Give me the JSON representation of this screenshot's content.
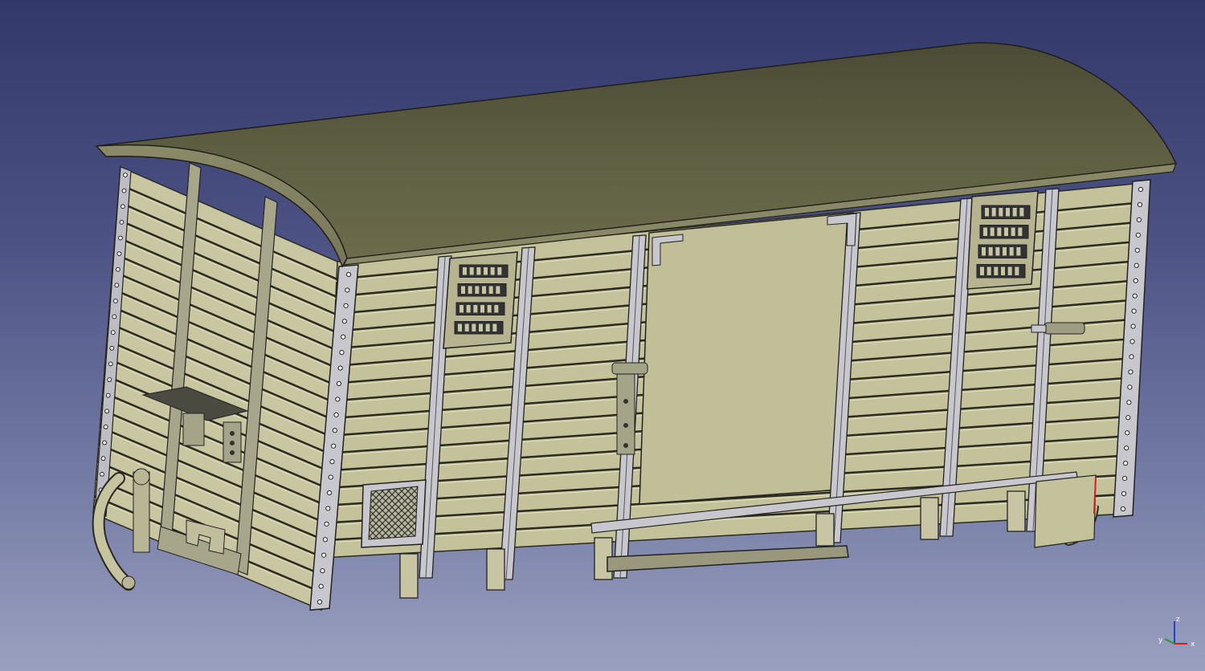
{
  "viewport": {
    "background_top": "#33386a",
    "background_bottom": "#9aa0bf"
  },
  "model": {
    "body_color": "#c4c29b",
    "roof_color": "#626245",
    "frame_color": "#c9c9cf"
  },
  "axes": {
    "x_label": "x",
    "y_label": "y",
    "z_label": "z",
    "x_color": "#d02020",
    "y_color": "#20a020",
    "z_color": "#2040d0"
  }
}
